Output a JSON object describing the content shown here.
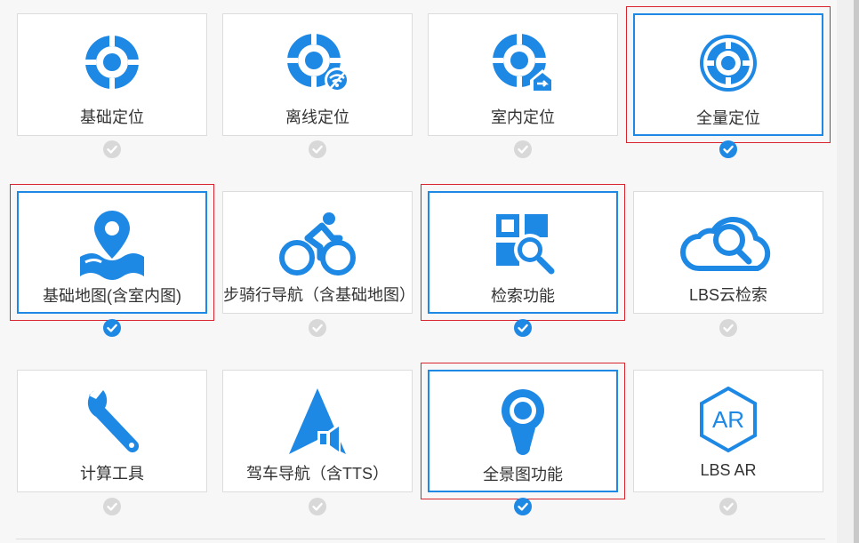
{
  "features": [
    {
      "label": "基础定位",
      "icon": "locate-icon",
      "selected": false
    },
    {
      "label": "离线定位",
      "icon": "offline-locate-icon",
      "selected": false
    },
    {
      "label": "室内定位",
      "icon": "indoor-locate-icon",
      "selected": false
    },
    {
      "label": "全量定位",
      "icon": "full-locate-icon",
      "selected": true
    },
    {
      "label": "基础地图(含室内图)",
      "icon": "map-pin-icon",
      "selected": true
    },
    {
      "label": "步骑行导航（含基础地图）",
      "icon": "cycling-icon",
      "selected": false
    },
    {
      "label": "检索功能",
      "icon": "search-grid-icon",
      "selected": true
    },
    {
      "label": "LBS云检索",
      "icon": "cloud-search-icon",
      "selected": false
    },
    {
      "label": "计算工具",
      "icon": "wrench-icon",
      "selected": false
    },
    {
      "label": "驾车导航（含TTS）",
      "icon": "navigation-voice-icon",
      "selected": false
    },
    {
      "label": "全景图功能",
      "icon": "panorama-pin-icon",
      "selected": true
    },
    {
      "label": "LBS AR",
      "icon": "ar-icon",
      "selected": false
    }
  ],
  "colors": {
    "accent": "#1e88e5",
    "highlight_outline": "#d9232d",
    "check_off": "#d8d8d8"
  }
}
